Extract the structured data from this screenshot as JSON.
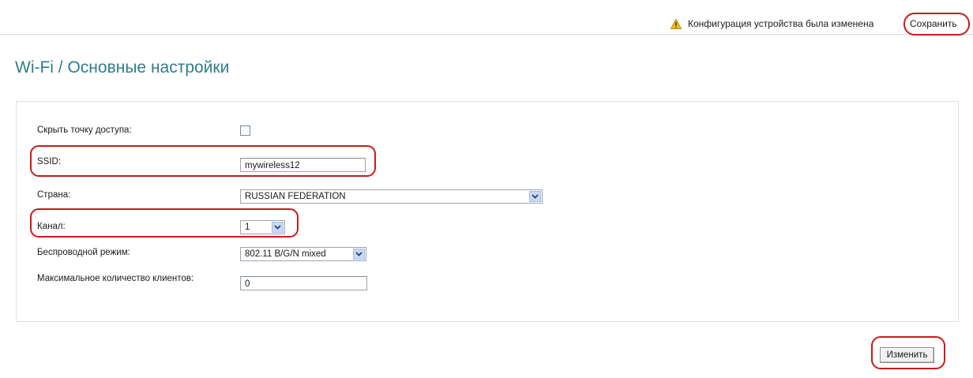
{
  "header": {
    "notice_text": "Конфигурация устройства была изменена",
    "notice_icon": "warning-icon",
    "save_label": "Сохранить"
  },
  "page": {
    "title": "Wi-Fi / Основные настройки"
  },
  "form": {
    "hide_ap": {
      "label": "Скрыть точку доступа:",
      "checked": false
    },
    "ssid": {
      "label": "SSID:",
      "value": "mywireless12"
    },
    "country": {
      "label": "Страна:",
      "value": "RUSSIAN FEDERATION"
    },
    "channel": {
      "label": "Канал:",
      "value": "1"
    },
    "wireless_mode": {
      "label": "Беспроводной режим:",
      "value": "802.11 B/G/N mixed"
    },
    "max_clients": {
      "label": "Максимальное количество клиентов:",
      "value": "0"
    }
  },
  "actions": {
    "apply_label": "Изменить"
  },
  "colors": {
    "title": "#2f7d8c",
    "highlight": "#c81b1b",
    "warning": "#f0c419"
  }
}
